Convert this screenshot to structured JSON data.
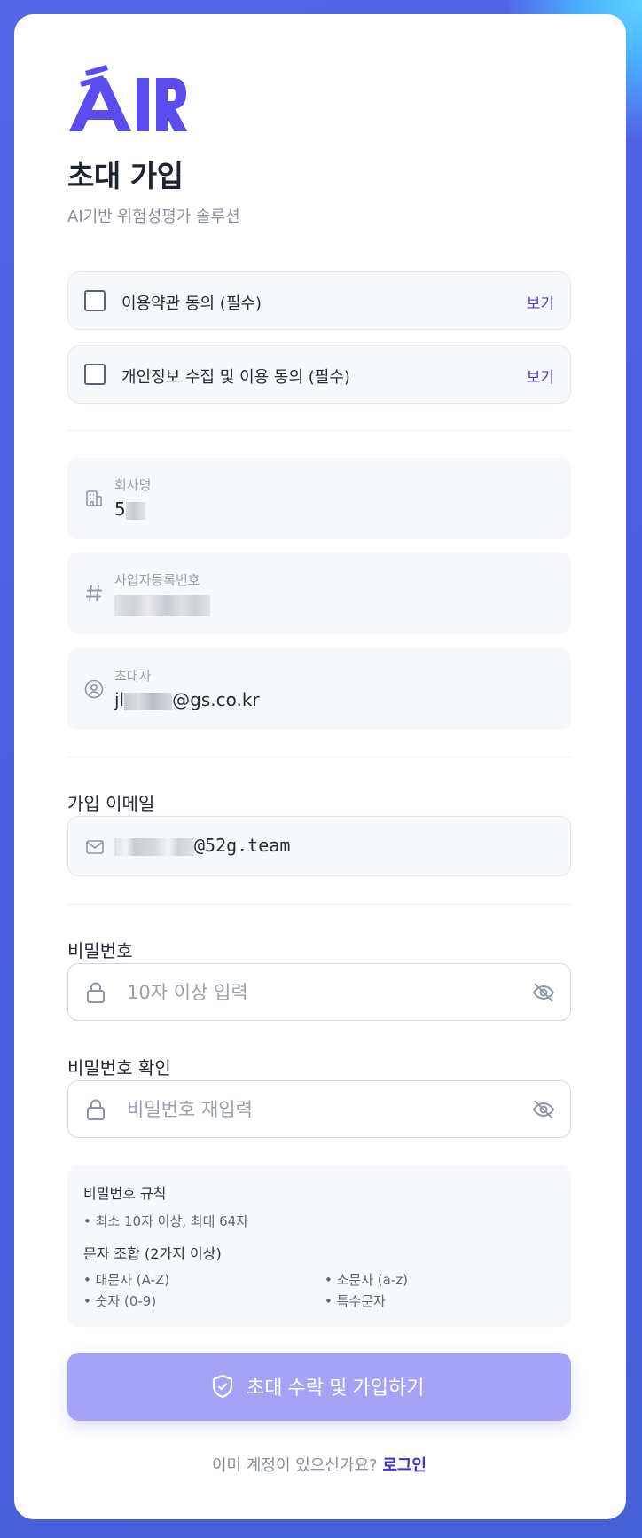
{
  "logo_text": "AIR",
  "title": "초대 가입",
  "subtitle": "AI기반 위험성평가 솔루션",
  "agreements": [
    {
      "label": "이용약관 동의 (필수)",
      "view": "보기"
    },
    {
      "label": "개인정보 수집 및 이용 동의 (필수)",
      "view": "보기"
    }
  ],
  "info": {
    "company": {
      "label": "회사명",
      "value_visible": "5"
    },
    "business_number": {
      "label": "사업자등록번호"
    },
    "inviter": {
      "label": "초대자",
      "value_prefix": "jl",
      "value_suffix": "@gs.co.kr"
    }
  },
  "email": {
    "label": "가입 이메일",
    "value_suffix": "@52g.team"
  },
  "password": {
    "label": "비밀번호",
    "placeholder": "10자 이상 입력"
  },
  "password_confirm": {
    "label": "비밀번호 확인",
    "placeholder": "비밀번호 재입력"
  },
  "rules": {
    "title": "비밀번호 규칙",
    "length": "• 최소 10자 이상, 최대 64자",
    "combo_title": "문자 조합 (2가지 이상)",
    "upper": "• 대문자 (A-Z)",
    "lower": "• 소문자 (a-z)",
    "digit": "• 숫자 (0-9)",
    "special": "• 특수문자"
  },
  "submit_label": "초대 수락 및 가입하기",
  "footer": {
    "question": "이미 계정이 있으신가요? ",
    "login": "로그인"
  },
  "colors": {
    "accent": "#5b4cf0",
    "button_disabled": "#a6a3f7",
    "link": "#4a3fe0"
  }
}
